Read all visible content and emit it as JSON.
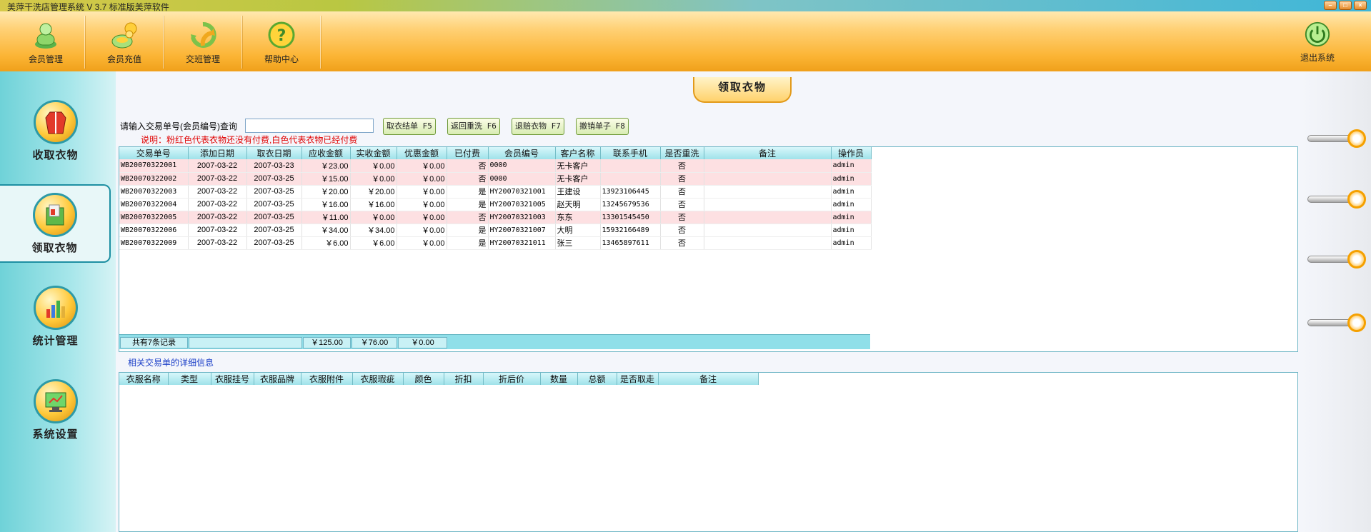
{
  "window": {
    "title": "美萍干洗店管理系统 V 3.7 标准版美萍软件",
    "buttons": [
      "–",
      "□",
      "×"
    ]
  },
  "toolbar": {
    "items": [
      {
        "label": "会员管理",
        "icon": "member-icon"
      },
      {
        "label": "会员充值",
        "icon": "recharge-icon"
      },
      {
        "label": "交班管理",
        "icon": "shift-icon"
      },
      {
        "label": "帮助中心",
        "icon": "help-icon"
      }
    ],
    "exit_label": "退出系统"
  },
  "sidebar": {
    "items": [
      {
        "label": "收取衣物",
        "icon": "coat-icon"
      },
      {
        "label": "领取衣物",
        "icon": "pickup-icon"
      },
      {
        "label": "统计管理",
        "icon": "chart-icon"
      },
      {
        "label": "系统设置",
        "icon": "monitor-icon"
      }
    ]
  },
  "page": {
    "title": "领取衣物",
    "query_label": "请输入交易单号(会员编号)查询",
    "query_value": "",
    "buttons": [
      "取衣结单 F5",
      "返回重洗 F6",
      "退赔衣物 F7",
      "撤销单子 F8"
    ],
    "note": "说明：粉红色代表衣物还没有付费,白色代表衣物已经付费",
    "related_label": "相关交易单的详细信息"
  },
  "orders": {
    "columns": [
      "交易单号",
      "添加日期",
      "取衣日期",
      "应收金额",
      "实收金额",
      "优惠金额",
      "已付费",
      "会员编号",
      "客户名称",
      "联系手机",
      "是否重洗",
      "备注",
      "操作员"
    ],
    "rows": [
      {
        "id": "WB20070322001",
        "add": "2007-03-22",
        "pick": "2007-03-23",
        "due": "￥23.00",
        "paid": "￥0.00",
        "disc": "￥0.00",
        "payed": "否",
        "member": "0000",
        "name": "无卡客户",
        "phone": "",
        "rewash": "否",
        "remark": "",
        "op": "admin",
        "unpaid": true
      },
      {
        "id": "WB20070322002",
        "add": "2007-03-22",
        "pick": "2007-03-25",
        "due": "￥15.00",
        "paid": "￥0.00",
        "disc": "￥0.00",
        "payed": "否",
        "member": "0000",
        "name": "无卡客户",
        "phone": "",
        "rewash": "否",
        "remark": "",
        "op": "admin",
        "unpaid": true
      },
      {
        "id": "WB20070322003",
        "add": "2007-03-22",
        "pick": "2007-03-25",
        "due": "￥20.00",
        "paid": "￥20.00",
        "disc": "￥0.00",
        "payed": "是",
        "member": "HY20070321001",
        "name": "王建设",
        "phone": "13923106445",
        "rewash": "否",
        "remark": "",
        "op": "admin",
        "unpaid": false
      },
      {
        "id": "WB20070322004",
        "add": "2007-03-22",
        "pick": "2007-03-25",
        "due": "￥16.00",
        "paid": "￥16.00",
        "disc": "￥0.00",
        "payed": "是",
        "member": "HY20070321005",
        "name": "赵天明",
        "phone": "13245679536",
        "rewash": "否",
        "remark": "",
        "op": "admin",
        "unpaid": false
      },
      {
        "id": "WB20070322005",
        "add": "2007-03-22",
        "pick": "2007-03-25",
        "due": "￥11.00",
        "paid": "￥0.00",
        "disc": "￥0.00",
        "payed": "否",
        "member": "HY20070321003",
        "name": "东东",
        "phone": "13301545450",
        "rewash": "否",
        "remark": "",
        "op": "admin",
        "unpaid": true
      },
      {
        "id": "WB20070322006",
        "add": "2007-03-22",
        "pick": "2007-03-25",
        "due": "￥34.00",
        "paid": "￥34.00",
        "disc": "￥0.00",
        "payed": "是",
        "member": "HY20070321007",
        "name": "大明",
        "phone": "15932166489",
        "rewash": "否",
        "remark": "",
        "op": "admin",
        "unpaid": false
      },
      {
        "id": "WB20070322009",
        "add": "2007-03-22",
        "pick": "2007-03-25",
        "due": "￥6.00",
        "paid": "￥6.00",
        "disc": "￥0.00",
        "payed": "是",
        "member": "HY20070321011",
        "name": "张三",
        "phone": "13465897611",
        "rewash": "否",
        "remark": "",
        "op": "admin",
        "unpaid": false
      }
    ],
    "footer": {
      "count": "共有7条记录",
      "due_total": "￥125.00",
      "paid_total": "￥76.00",
      "disc_total": "￥0.00"
    }
  },
  "details": {
    "columns": [
      "衣服名称",
      "类型",
      "衣服挂号",
      "衣服品牌",
      "衣服附件",
      "衣服瑕疵",
      "颜色",
      "折扣",
      "折后价",
      "数量",
      "总额",
      "是否取走",
      "备注"
    ]
  }
}
